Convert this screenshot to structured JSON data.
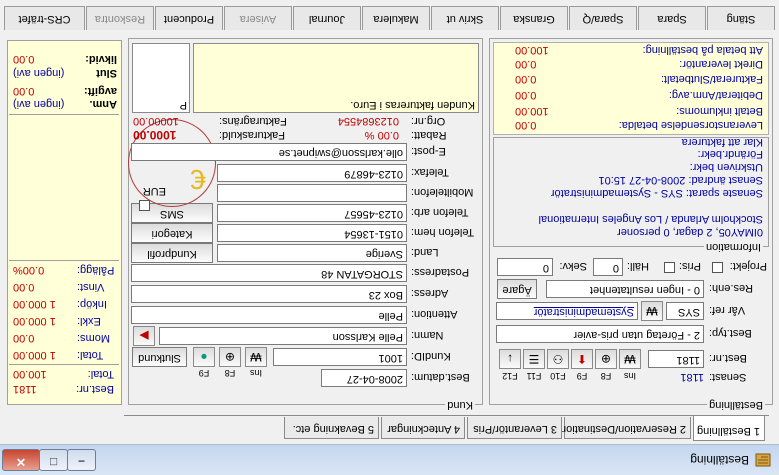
{
  "window": {
    "title": "Beställning"
  },
  "tabs": [
    "1 Beställning",
    "2 Reservation/Destination",
    "3 Leverantör/Pris",
    "4 Anteckningar",
    "5 Bevakning etc."
  ],
  "bestallning": {
    "group_label": "Beställning",
    "senast_label": "Senast:",
    "senast_value": "1181",
    "bestnr_label": "Best.nr:",
    "bestnr_value": "1181",
    "keys": [
      "Ins",
      "F8",
      "F9",
      "F10",
      "F11",
      "F12"
    ],
    "besttyp_label": "Best.typ:",
    "besttyp_value": "2 - Företag utan pris-avier",
    "varref_label": "Vår ref:",
    "varref_code": "SYS",
    "varref_name": "Systemadministratör",
    "resenh_label": "Res.enh:",
    "resenh_value": "0 - Ingen resultatenhet",
    "agare_label": "Ägare",
    "projekt_label": "Projekt:",
    "pris_label": "Pris:",
    "hall_label": "Häll:",
    "hall_value": "0",
    "sekv_label": "Sekv:",
    "sekv_value": "0",
    "information_label": "Information",
    "info_lines": [
      "0IMAY05, 2 dagar, 0 personer",
      "Stockholm Arlanda / Los Angeles International",
      "",
      "Senaste sparat: SYS - Systemadministratör",
      "Senast ändrad: 2008-04-27 15:01",
      "Utskriven bekr:",
      "Förändr.bekr:",
      "Klar att fakturera"
    ]
  },
  "kund": {
    "group_label": "Kund",
    "bestdatum_label": "Best.datum:",
    "bestdatum_value": "2008-04-27",
    "kundid_label": "KundID:",
    "kundid_value": "1001",
    "slutkund_label": "Slutkund",
    "keys": [
      "Ins",
      "F8",
      "F9"
    ],
    "namn_label": "Namn:",
    "namn_value": "Pelle Karlsson",
    "attention_label": "Attention:",
    "attention_value": "Pelle",
    "adress_label": "Adress:",
    "adress_value": "Box 23",
    "postadress_label": "Postadress:",
    "postadress_value": "STORGATAN 48",
    "land_label": "Land:",
    "land_value": "Sverige",
    "kundprofil_label": "Kundprofil",
    "telefonhem_label": "Telefon hem:",
    "telefonhem_value": "0151-13654",
    "kategori_label": "Kategori",
    "telefonarb_label": "Telefon arb:",
    "telefonarb_value": "0123-45657",
    "sms_label": "SMS",
    "mobil_label": "Mobiltelefon:",
    "mobil_value": "",
    "telefax_label": "Telefax:",
    "telefax_value": "0123-46879",
    "epost_label": "E-post:",
    "epost_value": "olle.karlsson@swipnet.se",
    "currency_code": "EUR",
    "rabatt_label": "Rabatt:",
    "rabatt_value": "0.00 %",
    "fakturaskuld_label": "Fakturaskuld:",
    "fakturaskuld_value": "1000.00",
    "orgnr_label": "Org.nr:",
    "orgnr_value": "0123684554",
    "fakturagrans_label": "Fakturagräns:",
    "fakturagrans_value": "10000.00",
    "note": "Kunden faktureras i Euro.",
    "note_suffix": "P"
  },
  "summary": {
    "lines": [
      {
        "label": "Leveranstorsendelse betalda:",
        "value": "0.00"
      },
      {
        "label": "Betalt inklumoms:",
        "value": "100.00"
      },
      {
        "label": "Debiterat/Anm.avg:",
        "value": "0.00"
      },
      {
        "label": "Fakturerat/Slutbetalt:",
        "value": "0.00"
      },
      {
        "label": "Direkt leverantör:",
        "value": "0.00"
      },
      {
        "label": "Att betala på beställning:",
        "value": "100.00"
      }
    ]
  },
  "side": {
    "bestnr_label": "Best.nr:",
    "bestnr_value": "1181",
    "total_label": "Total:",
    "total_value": "100.00",
    "rows": [
      {
        "label": "Total:",
        "value": "1 000.00"
      },
      {
        "label": "Moms:",
        "value": "0.00"
      },
      {
        "label": "Exkl:",
        "value": "1 000.00"
      },
      {
        "label": "Inköp:",
        "value": "1 000.00"
      },
      {
        "label": "Vinst:",
        "value": "0.00"
      },
      {
        "label": "Pålägg:",
        "value": "0.00%"
      }
    ],
    "top_rows": [
      {
        "label": "Anm.",
        "value": "(ingen avi)"
      },
      {
        "label": "avgift:",
        "value": "0.00"
      },
      {
        "label": "Slut",
        "value": "(ingen avi)"
      },
      {
        "label": "likvid:",
        "value": "0.00"
      }
    ]
  },
  "bottom_tabs": [
    "CRS-träfet",
    "Reskontra",
    "Producent",
    "Avisera",
    "Journal",
    "Makulera",
    "Skriv ut",
    "Granska",
    "Spara/Q",
    "Spara",
    "Stäng"
  ]
}
